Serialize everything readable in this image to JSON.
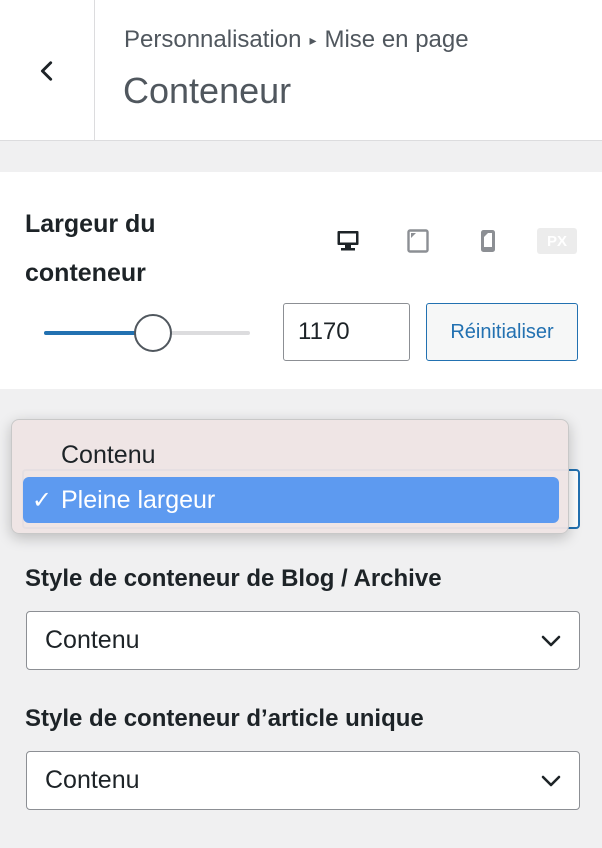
{
  "header": {
    "breadcrumb_parent": "Personnalisation",
    "breadcrumb_separator": "▸",
    "breadcrumb_current": "Mise en page",
    "title": "Conteneur",
    "back_icon": "chevron-left-icon"
  },
  "width_control": {
    "label": "Largeur du conteneur",
    "devices": [
      {
        "name": "desktop",
        "icon": "desktop-icon",
        "active": true
      },
      {
        "name": "tablet",
        "icon": "tablet-icon",
        "active": false
      },
      {
        "name": "mobile",
        "icon": "mobile-icon",
        "active": false
      }
    ],
    "unit": "PX",
    "value": "1170",
    "slider_fraction": 0.53,
    "reset_label": "Réinitialiser"
  },
  "layout_dropdown": {
    "options": [
      {
        "label": "Contenu",
        "selected": false
      },
      {
        "label": "Pleine largeur",
        "selected": true
      }
    ],
    "check_mark": "✓"
  },
  "blog_archive": {
    "label": "Style de conteneur de Blog / Archive",
    "value": "Contenu"
  },
  "single_article": {
    "label": "Style de conteneur d’article unique",
    "value": "Contenu"
  },
  "colors": {
    "accent": "#2271b1",
    "highlight": "#5d9af0",
    "background": "#f0f0f1"
  }
}
